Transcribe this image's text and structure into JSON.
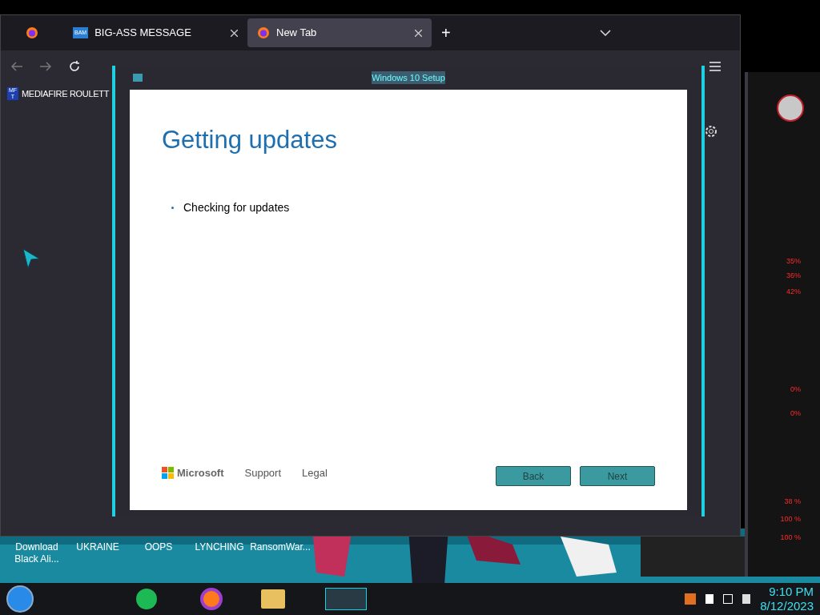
{
  "browser": {
    "tabs": [
      {
        "label": "BIG-ASS MESSAGE",
        "icon_text": "BAM",
        "selected": false
      },
      {
        "label": "New Tab",
        "selected": true
      }
    ],
    "new_tab": "+",
    "bookmark": {
      "label": "MEDIAFIRE ROULETT",
      "icon_text": "MF T"
    }
  },
  "setup": {
    "title": "Windows 10 Setup",
    "heading": "Getting updates",
    "status": "Checking for updates",
    "brand": "Microsoft",
    "links": [
      "Support",
      "Legal"
    ],
    "buttons": [
      "Back",
      "Next"
    ]
  },
  "desktop_icons": [
    "Download Black Ali...",
    "UKRAINE",
    "OOPS",
    "LYNCHING",
    "RansomWar..."
  ],
  "gadget": {
    "readings": [
      "35%",
      "36%",
      "42%",
      "0%",
      "0%",
      "38 %",
      "100 %",
      "100 %"
    ]
  },
  "clock": {
    "time": "9:10 PM",
    "date": "8/12/2023"
  }
}
